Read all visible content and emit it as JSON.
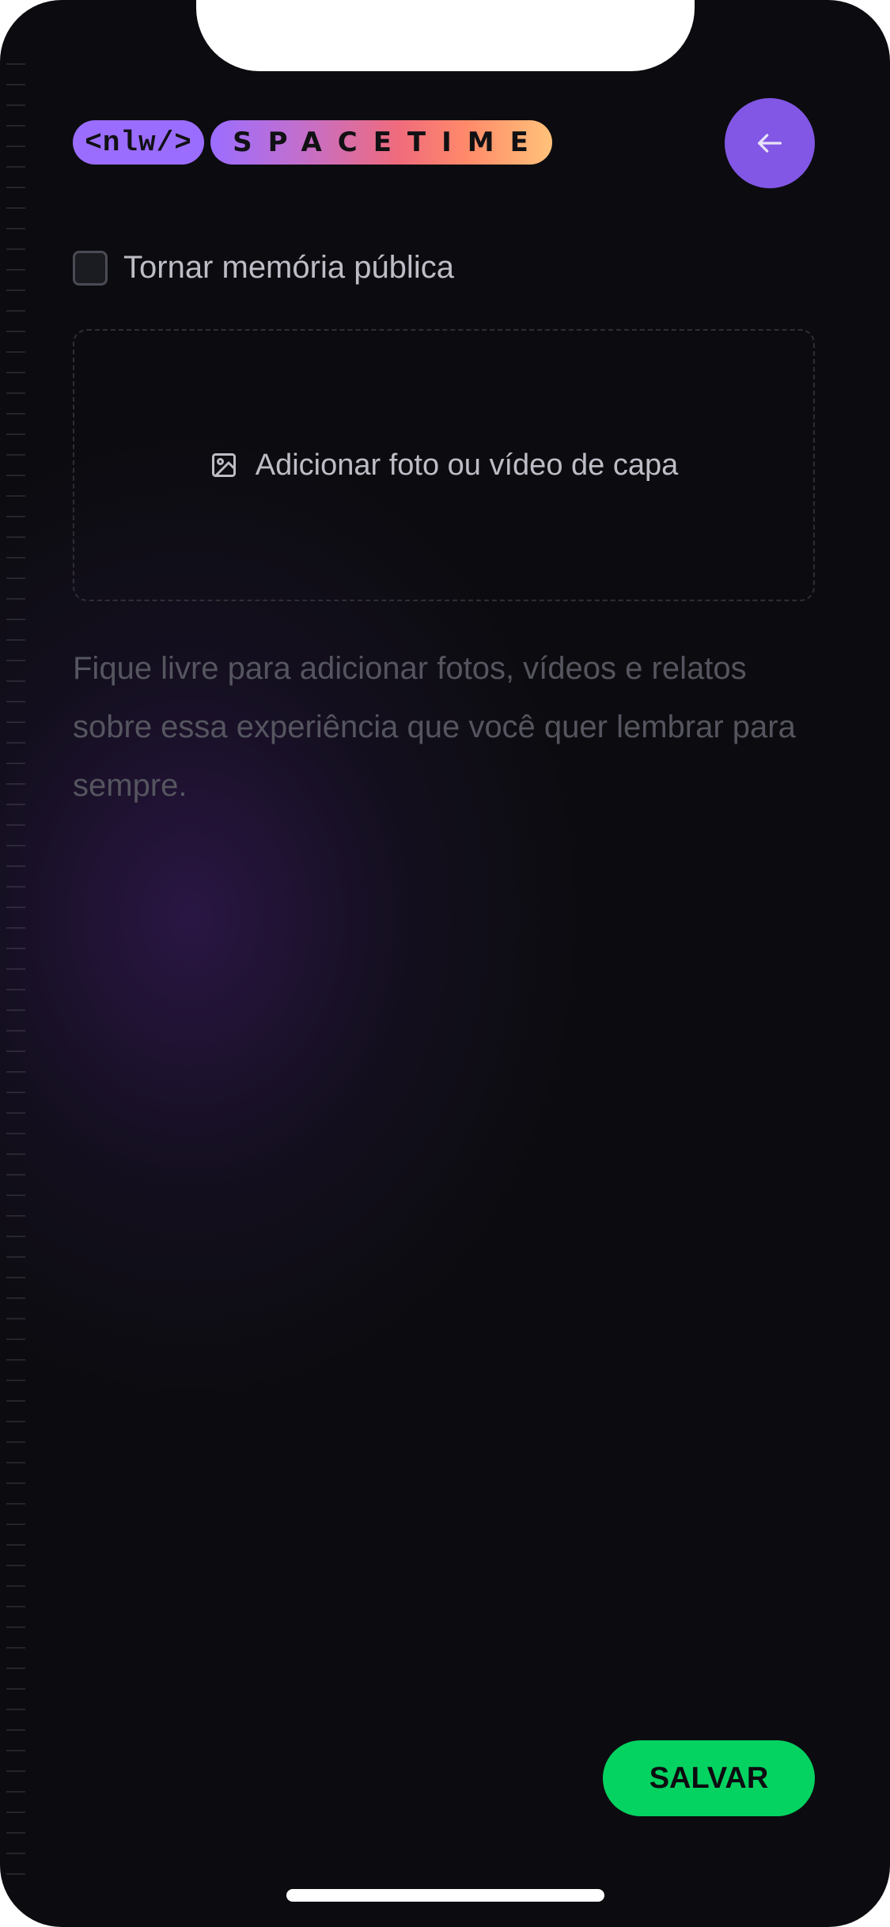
{
  "header": {
    "logo_badge": "<nlw/>",
    "logo_name": "SPACETIME",
    "back_icon": "arrow-left-icon"
  },
  "form": {
    "public_checkbox": {
      "label": "Tornar memória pública",
      "checked": false
    },
    "cover": {
      "label": "Adicionar foto ou vídeo de capa",
      "icon": "image-icon"
    },
    "content": {
      "value": "",
      "placeholder": "Fique livre para adicionar fotos, vídeos e relatos sobre essa experiência que você quer lembrar para sempre."
    },
    "save_label": "SALVAR"
  },
  "colors": {
    "background": "#0c0c10",
    "accent_purple": "#8257e5",
    "save_green": "#04d361",
    "logo_gradient": [
      "#9b6dff",
      "#f06b7c",
      "#ffc27a"
    ]
  }
}
